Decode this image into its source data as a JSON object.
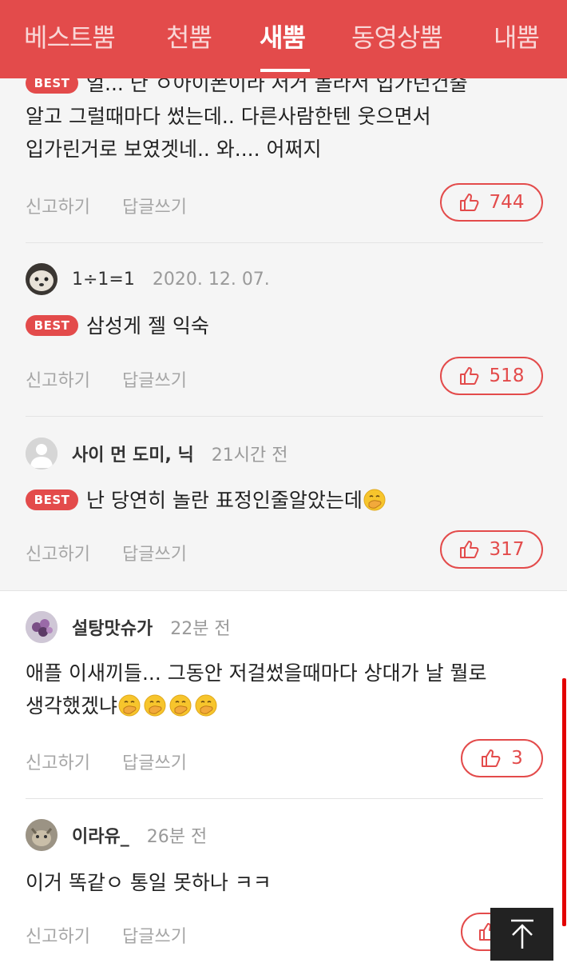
{
  "nav": {
    "tabs": [
      {
        "label": "베스트뿜"
      },
      {
        "label": "천뿜"
      },
      {
        "label": "새뿜"
      },
      {
        "label": "동영상뿜"
      },
      {
        "label": "내뿜"
      }
    ],
    "active_tab": "새뿜"
  },
  "common": {
    "report_label": "신고하기",
    "reply_label": "답글쓰기",
    "best_badge": "BEST"
  },
  "comments": [
    {
      "text_lines": [
        "얼... 난 ㅇ아이폰이라 저거 놀라서 입가던건줄",
        "알고 그럴때마다 썼는데.. 다른사람한텐 웃으면서",
        "입가린거로 보였겟네.. 와.... 어쩌지"
      ],
      "best": true,
      "likes": "744"
    },
    {
      "author": "1÷1=1",
      "time": "2020. 12. 07.",
      "text": "삼성게 젤 익숙",
      "best": true,
      "likes": "518"
    },
    {
      "author": "사이 먼 도미, 닉",
      "time": "21시간 전",
      "text": "난 당연히 놀란 표정인줄알았는데",
      "best": true,
      "likes": "317",
      "emoji_count": 1
    },
    {
      "author": "설탕맛슈가",
      "time": "22분 전",
      "text_lines": [
        "애플 이새끼들... 그동안 저걸썼을때마다 상대가 날 뭘로",
        "생각했겠냐"
      ],
      "best": false,
      "likes": "3",
      "emoji_count": 4
    },
    {
      "author": "이라유_",
      "time": "26분 전",
      "text": "이거 똑같ㅇ 통일 못하나 ㅋㅋ",
      "best": false,
      "likes": ""
    }
  ],
  "colors": {
    "brand": "#e34b4b",
    "best_bg": "#f5f5f5",
    "scrollbar": "#e30000"
  },
  "icons": [
    "thumbs-up-icon",
    "arrow-up-to-top-icon",
    "hand-over-mouth-emoji"
  ]
}
